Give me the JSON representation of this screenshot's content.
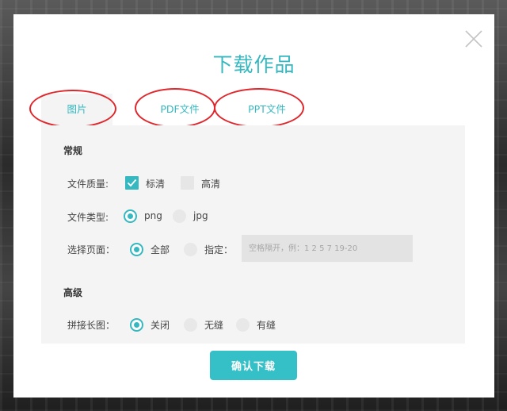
{
  "dialog": {
    "title": "下载作品",
    "tabs": [
      {
        "label": "图片",
        "active": true
      },
      {
        "label": "PDF文件",
        "active": false
      },
      {
        "label": "PPT文件",
        "active": false
      }
    ],
    "annotation_color": "#e0262b",
    "accent_color": "#35b8c0"
  },
  "general": {
    "section_title": "常规",
    "quality": {
      "label": "文件质量:",
      "options": [
        {
          "label": "标清",
          "checked": true
        },
        {
          "label": "高清",
          "checked": false
        }
      ]
    },
    "file_type": {
      "label": "文件类型:",
      "options": [
        {
          "label": "png",
          "selected": true
        },
        {
          "label": "jpg",
          "selected": false
        }
      ]
    },
    "pages": {
      "label": "选择页面：",
      "options": [
        {
          "label": "全部",
          "selected": true
        },
        {
          "label": "指定：",
          "selected": false
        }
      ],
      "input_placeholder": "空格隔开，例：1 2 5 7 19-20"
    }
  },
  "advanced": {
    "section_title": "高级",
    "stitch": {
      "label": "拼接长图：",
      "options": [
        {
          "label": "关闭",
          "selected": true
        },
        {
          "label": "无缝",
          "selected": false
        },
        {
          "label": "有缝",
          "selected": false
        }
      ]
    }
  },
  "confirm_label": "确认下载"
}
